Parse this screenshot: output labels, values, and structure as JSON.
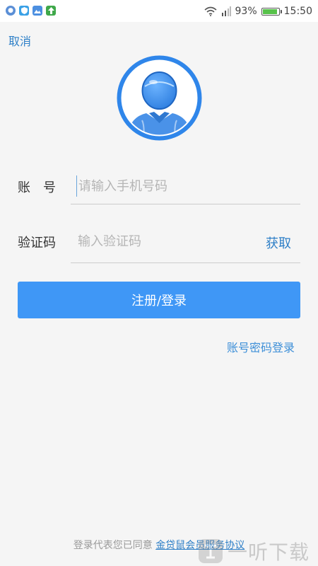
{
  "status_bar": {
    "battery_percent": "93%",
    "battery_level": 0.93,
    "time": "15:50",
    "app_icons": [
      {
        "name": "app-round-icon",
        "color": "#5b8fd6"
      },
      {
        "name": "shield-app-icon",
        "color": "#3aa1e6"
      },
      {
        "name": "photo-app-icon",
        "color": "#4c8fe0"
      },
      {
        "name": "upload-app-icon",
        "color": "#3fa84a"
      }
    ]
  },
  "header": {
    "cancel_label": "取消"
  },
  "form": {
    "account_label": "账　号",
    "account_placeholder": "请输入手机号码",
    "code_label": "验证码",
    "code_placeholder": "输入验证码",
    "get_code_label": "获取"
  },
  "actions": {
    "register_label": "注册/登录",
    "password_login_label": "账号密码登录"
  },
  "footer": {
    "prefix": "登录代表您已同意",
    "agreement_link": "金贷鼠会员服务协议"
  },
  "watermark": {
    "text": "一听下载"
  },
  "colors": {
    "accent": "#3f97f6",
    "link": "#2e7fc7"
  }
}
